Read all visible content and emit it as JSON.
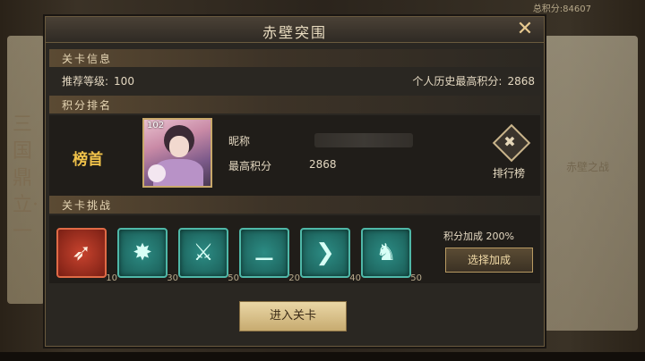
{
  "background": {
    "top_score_text": "总积分:84607",
    "left_scroll_text": "三国鼎立·一",
    "right_map_label": "赤壁之战"
  },
  "dialog": {
    "title": "赤壁突围",
    "close_icon": "close-icon",
    "level_info": {
      "header": "关卡信息",
      "recommended_label": "推荐等级:",
      "recommended_value": "100",
      "best_label": "个人历史最高积分:",
      "best_value": "2868"
    },
    "ranking": {
      "header": "积分排名",
      "first_label": "榜首",
      "portrait_level": "102",
      "nickname_label": "昵称",
      "score_label": "最高积分",
      "score_value": "2868",
      "leaderboard_label": "排行榜"
    },
    "challenge": {
      "header": "关卡挑战",
      "skills": [
        {
          "icon": "horn-icon",
          "glyph": "➶",
          "cost": "10",
          "color": "red"
        },
        {
          "icon": "burst-sword-icon",
          "glyph": "✸",
          "cost": "30",
          "color": "teal"
        },
        {
          "icon": "crossed-blades-icon",
          "glyph": "⚔",
          "cost": "50",
          "color": "teal"
        },
        {
          "icon": "dagger-icon",
          "glyph": "⚊",
          "cost": "20",
          "color": "teal"
        },
        {
          "icon": "chevron-arrow-icon",
          "glyph": "❯",
          "cost": "40",
          "color": "teal"
        },
        {
          "icon": "cavalry-icon",
          "glyph": "♞",
          "cost": "50",
          "color": "teal"
        }
      ],
      "bonus_text": "积分加成 200%",
      "select_bonus_label": "选择加成"
    },
    "enter_label": "进入关卡"
  }
}
